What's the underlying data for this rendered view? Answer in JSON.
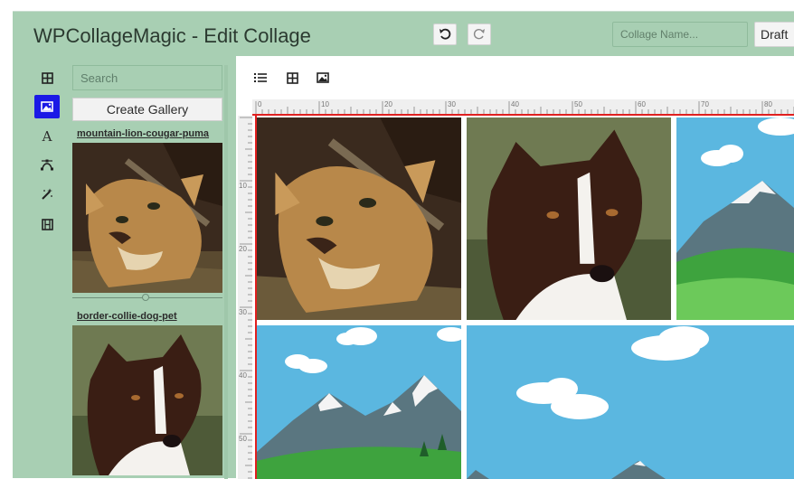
{
  "header": {
    "title": "WPCollageMagic - Edit Collage",
    "collage_name_placeholder": "Collage Name...",
    "draft_label": "Draft"
  },
  "tools": [
    {
      "name": "grid-tool",
      "icon": "grid-icon"
    },
    {
      "name": "image-tool",
      "icon": "image-icon",
      "active": true
    },
    {
      "name": "text-tool",
      "icon": "text-icon"
    },
    {
      "name": "path-tool",
      "icon": "bezier-icon"
    },
    {
      "name": "effects-tool",
      "icon": "magic-wand-icon"
    },
    {
      "name": "film-tool",
      "icon": "film-icon"
    }
  ],
  "sidebar": {
    "search_placeholder": "Search",
    "create_gallery_label": "Create Gallery",
    "galleries": [
      {
        "label": "mountain-lion-cougar-puma"
      },
      {
        "label": "border-collie-dog-pet"
      }
    ]
  },
  "editor": {
    "toolbar": [
      {
        "name": "list-view-button",
        "icon": "list-icon"
      },
      {
        "name": "grid-view-button",
        "icon": "grid-icon"
      },
      {
        "name": "image-view-button",
        "icon": "image-icon"
      }
    ],
    "ruler_h_labels": [
      "0",
      "10",
      "20",
      "30",
      "40",
      "50",
      "60",
      "70",
      "80"
    ],
    "ruler_v_labels": [
      "10",
      "20",
      "30",
      "40",
      "50"
    ]
  },
  "colors": {
    "panel_green": "#a8cfb3",
    "active_tool": "#1a19e6",
    "guide_red": "#e02020"
  }
}
